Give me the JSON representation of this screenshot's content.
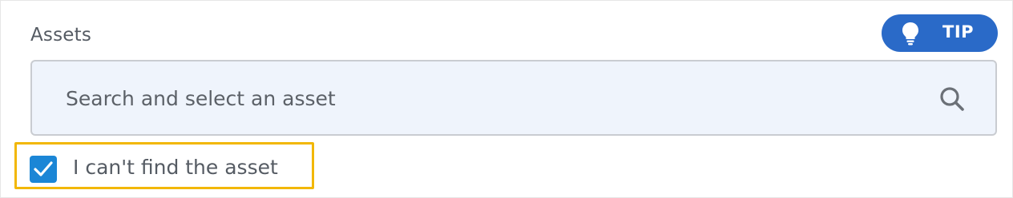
{
  "assets_field": {
    "label": "Assets",
    "search": {
      "placeholder": "Search and select an asset",
      "value": "",
      "icon": "search-icon"
    }
  },
  "tip_button": {
    "label": "TIP",
    "icon": "lightbulb-icon",
    "color": "#2a6ac8"
  },
  "cant_find": {
    "label": "I can't find the asset",
    "checked": true,
    "checkbox_color": "#1b86d6",
    "highlight_color": "#f2b705"
  }
}
